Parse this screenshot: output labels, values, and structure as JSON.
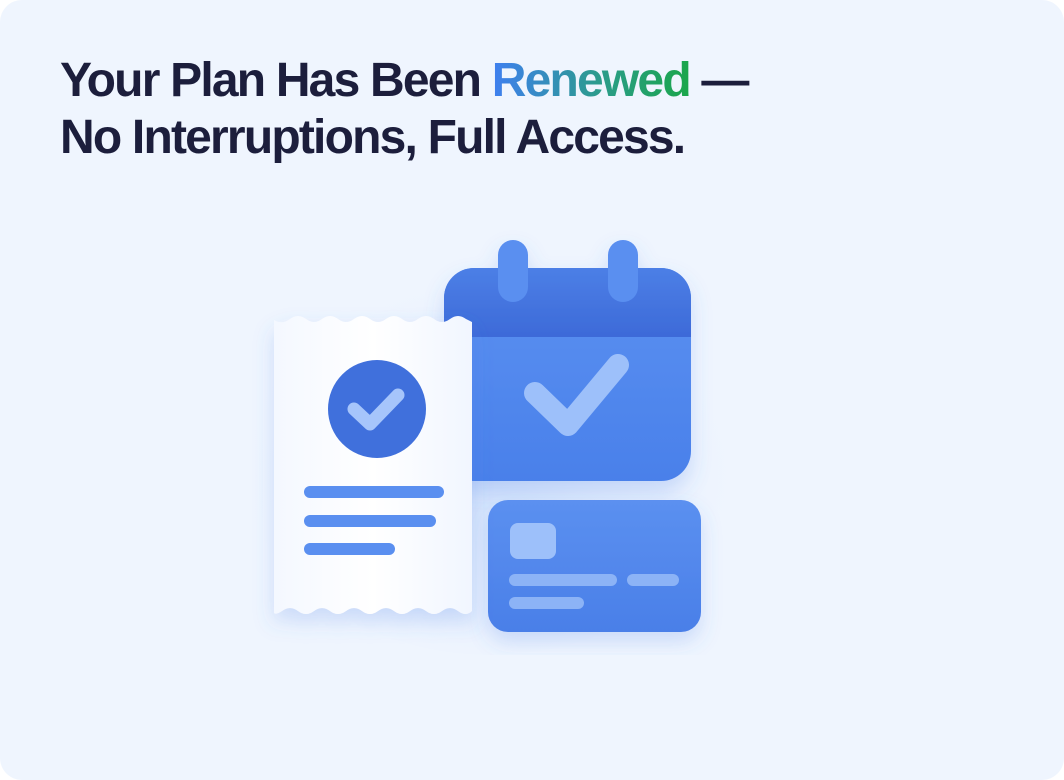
{
  "headline": {
    "line1_before": "Your Plan Has Been ",
    "line1_accent": "Renewed",
    "line1_after": " —",
    "line2": "No Interruptions, Full Access."
  },
  "colors": {
    "background": "#eff5fe",
    "text": "#1c1e3c",
    "accent_gradient": [
      "#3f7ff0",
      "#1aa64a"
    ],
    "icon_blue": "#4f86ec",
    "icon_dark_blue": "#3d6ad8",
    "icon_light_blue": "#8fb5f7"
  },
  "illustration": {
    "icons": [
      "receipt-icon",
      "calendar-check-icon",
      "credit-card-icon"
    ]
  }
}
